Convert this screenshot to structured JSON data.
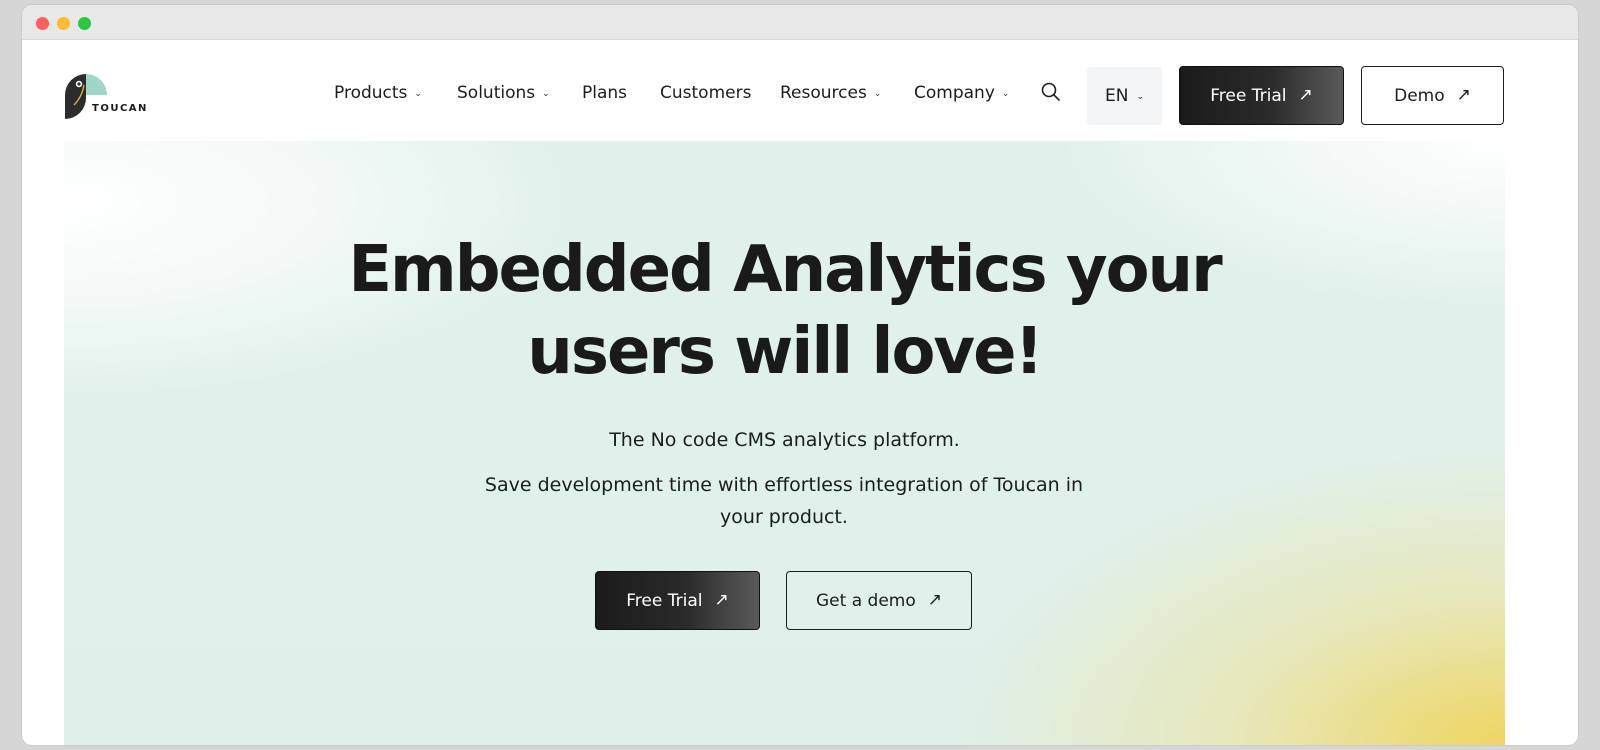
{
  "window": {
    "controls": [
      "close",
      "minimize",
      "maximize"
    ]
  },
  "logo": {
    "text": "TOUCAN",
    "icon": "toucan-logo-icon"
  },
  "nav": {
    "items": [
      {
        "label": "Products",
        "has_dropdown": true
      },
      {
        "label": "Solutions",
        "has_dropdown": true
      },
      {
        "label": "Plans",
        "has_dropdown": false
      },
      {
        "label": "Customers",
        "has_dropdown": false
      },
      {
        "label": "Resources",
        "has_dropdown": true
      },
      {
        "label": "Company",
        "has_dropdown": true
      }
    ],
    "search_icon": "search-icon",
    "language": "EN",
    "free_trial_label": "Free Trial",
    "demo_label": "Demo"
  },
  "hero": {
    "title_line1": "Embedded Analytics your",
    "title_line2": "users will love!",
    "subtitle": "The No code CMS analytics platform.",
    "description": "Save development time with effortless integration of Toucan in your product.",
    "primary_cta": "Free Trial",
    "secondary_cta": "Get a demo"
  },
  "colors": {
    "primary_dark": "#1b1b1b",
    "hero_mint": "#dff0ea",
    "hero_yellow": "#f0d45a",
    "logo_teal": "#9fd6c9"
  }
}
